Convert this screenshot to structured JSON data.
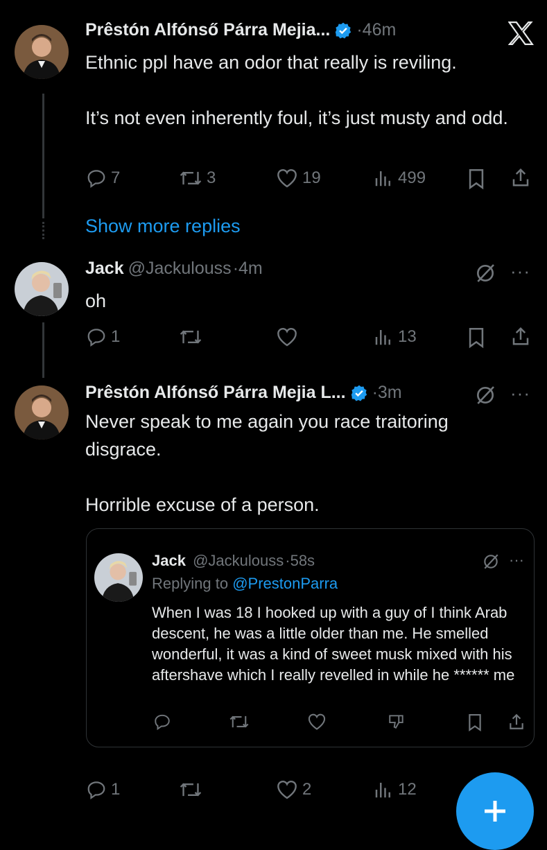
{
  "tweets": [
    {
      "name": "Prêstón Alfónső Párra Mejia...",
      "time": "46m",
      "text": "Ethnic ppl have an odor that really is reviling.\n\nIt’s not even inherently foul, it’s just musty and odd.",
      "replies": "7",
      "retweets": "3",
      "likes": "19",
      "views": "499"
    },
    {
      "name": "Jack",
      "handle": "@Jackulouss",
      "time": "4m",
      "text": "oh",
      "replies": "1",
      "views": "13"
    },
    {
      "name": "Prêstón Alfónső Párra Mejia L...",
      "time": "3m",
      "text": "Never speak to me again you race traitoring disgrace.\n\nHorrible excuse of a person.",
      "replies": "1",
      "likes": "2",
      "views": "12"
    }
  ],
  "show_more_replies": "Show more replies",
  "quote": {
    "name": "Jack",
    "handle": "@Jackulouss",
    "time": "58s",
    "replying_prefix": "Replying to",
    "replying_to": "@PrestonParra",
    "text": "When I was 18 I hooked up with a guy of I think Arab descent, he was a little older than me. He smelled wonderful, it was a kind of sweet musk mixed with his aftershave which I really revelled in while he ****** me"
  },
  "icons": [
    "x-logo",
    "verified-badge",
    "reply-icon",
    "retweet-icon",
    "like-icon",
    "views-icon",
    "bookmark-icon",
    "share-icon",
    "more-icon",
    "grok-icon",
    "compose-plus-icon"
  ],
  "colors": {
    "background": "#000000",
    "accent": "#1d9bf0",
    "muted": "#71767b",
    "text": "#e7e9ea"
  }
}
